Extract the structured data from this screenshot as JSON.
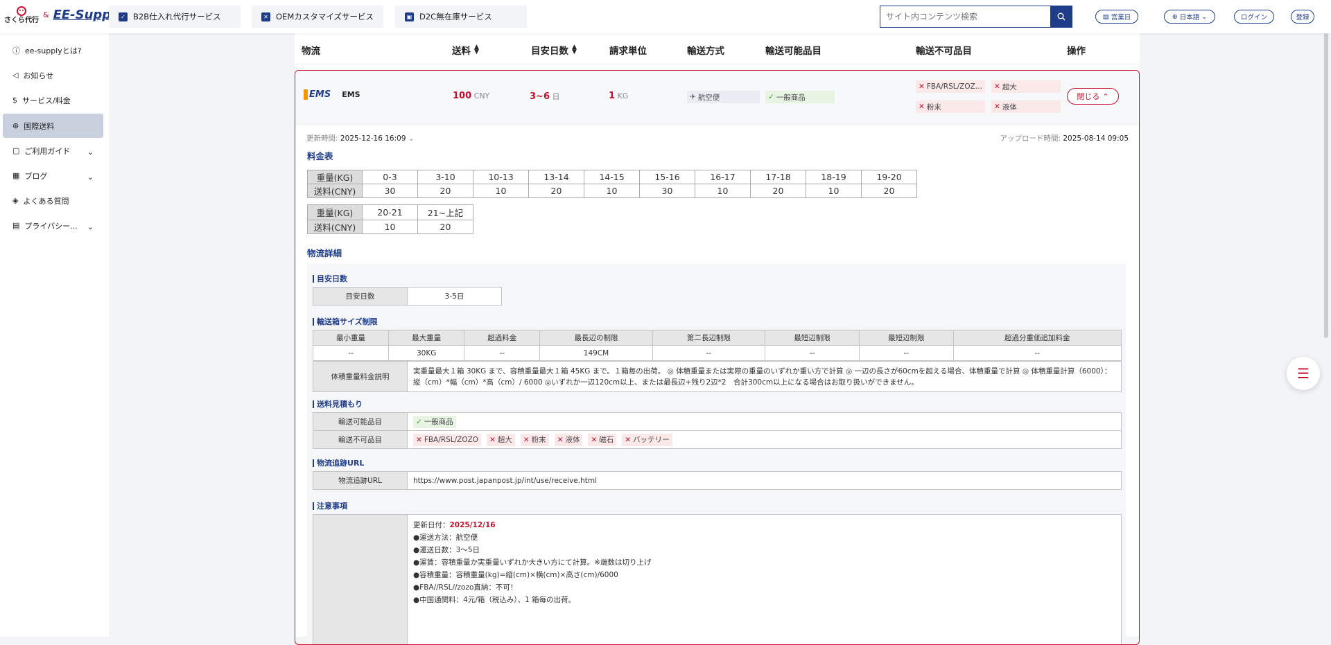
{
  "header": {
    "logo_sakura": "さくら代行",
    "logo_amp": "&",
    "logo_ee": "EE-Supply",
    "tabs": [
      {
        "label": "B2B仕入れ代行サービス"
      },
      {
        "label": "OEMカスタマイズサービス"
      },
      {
        "label": "D2C無在庫サービス"
      }
    ],
    "search_placeholder": "サイト内コンテンツ検索",
    "btn_business": "営業日",
    "btn_lang": "日本語",
    "btn_login": "ログイン",
    "btn_register": "登録"
  },
  "sidebar": {
    "items": [
      {
        "label": "ee-supplyとは?"
      },
      {
        "label": "お知らせ"
      },
      {
        "label": "サービス/料金"
      },
      {
        "label": "国際送料"
      },
      {
        "label": "ご利用ガイド"
      },
      {
        "label": "ブログ"
      },
      {
        "label": "よくある質問"
      },
      {
        "label": "プライバシー..."
      }
    ]
  },
  "table_head": {
    "logistics": "物流",
    "fee": "送料",
    "days": "目安日数",
    "unit": "請求単位",
    "method": "輸送方式",
    "allowed": "輸送可能品目",
    "forbidden": "輸送不可品目",
    "action": "操作"
  },
  "row": {
    "carrier_logo": "EMS",
    "carrier": "EMS",
    "fee_value": "100",
    "fee_unit": "CNY",
    "days_value": "3~6",
    "days_unit": "日",
    "unit_value": "1",
    "unit_unit": "KG",
    "method": "航空便",
    "allowed": "一般商品",
    "forbidden": [
      "FBA/RSL/ZOZ...",
      "超大",
      "粉末",
      "液体"
    ],
    "close": "閉じる"
  },
  "detail": {
    "updated_label": "更新時間:",
    "updated_value": "2025-12-16 16:09",
    "uploaded_label": "アップロード時間:",
    "uploaded_value": "2025-08-14 09:05",
    "rate_title": "料金表",
    "weight_label": "重量(KG)",
    "fee_label": "送料(CNY)",
    "rates1": [
      {
        "w": "0-3",
        "f": "30"
      },
      {
        "w": "3-10",
        "f": "20"
      },
      {
        "w": "10-13",
        "f": "10"
      },
      {
        "w": "13-14",
        "f": "20"
      },
      {
        "w": "14-15",
        "f": "10"
      },
      {
        "w": "15-16",
        "f": "30"
      },
      {
        "w": "16-17",
        "f": "10"
      },
      {
        "w": "17-18",
        "f": "20"
      },
      {
        "w": "18-19",
        "f": "10"
      },
      {
        "w": "19-20",
        "f": "20"
      }
    ],
    "rates2": [
      {
        "w": "20-21",
        "f": "10"
      },
      {
        "w": "21~上記",
        "f": "20"
      }
    ],
    "logistics_title": "物流詳細",
    "days_section": "目安日数",
    "days_label": "目安日数",
    "days_value": "3-5日",
    "box_section": "輸送箱サイズ制限",
    "box_headers": [
      "最小重量",
      "最大重量",
      "超過料金",
      "最長辺の制限",
      "第二長辺制限",
      "最短辺制限",
      "最短辺制限",
      "超過分重価追加料金"
    ],
    "box_values": [
      "--",
      "30KG",
      "--",
      "149CM",
      "--",
      "--",
      "--",
      "--"
    ],
    "vol_label": "体積重量料金説明",
    "vol_text": "実重量最大１箱 30KG まで、容積重量最大１箱 45KG まで。１箱毎の出荷。 ◎ 体積重量または実際の重量のいずれか重い方で計算 ◎ 一辺の長さが60cmを超える場合、体積重量で計算 ◎ 体積重量計算（6000）：縦（cm）*幅（cm）*高（cm）/ 6000 ◎いずれか一辺120cm以上、または最長辺+残り2辺*2　合計300cm以上になる場合はお取り扱いができません。",
    "estimate_section": "送料見積もり",
    "allowed_label": "輸送可能品目",
    "allowed_items": [
      "一般商品"
    ],
    "forbidden_label": "輸送不可品目",
    "forbidden_items": [
      "FBA/RSL/ZOZO",
      "超大",
      "粉末",
      "液体",
      "磁石",
      "バッテリー"
    ],
    "tracking_section": "物流追跡URL",
    "tracking_label": "物流追跡URL",
    "tracking_url": "https://www.post.japanpost.jp/int/use/receive.html",
    "notes_section": "注意事項",
    "notes_date_label": "更新日付：",
    "notes_date": "2025/12/16",
    "notes": [
      "●運送方法：航空便",
      "●運送日数：3～5日",
      "●運賃：容積重量か実重量いずれか大きい方にて計算。※端数は切り上げ",
      "●容積重量：容積重量(kg)=縦(cm)×横(cm)×高さ(cm)/6000",
      "●FBA//RSL//zozo直納：不可！",
      "●中国通関料：4元/箱（税込み）、1 箱毎の出荷。"
    ]
  },
  "colors": {
    "brand": "#1f3c88",
    "accent": "#c8102e"
  }
}
